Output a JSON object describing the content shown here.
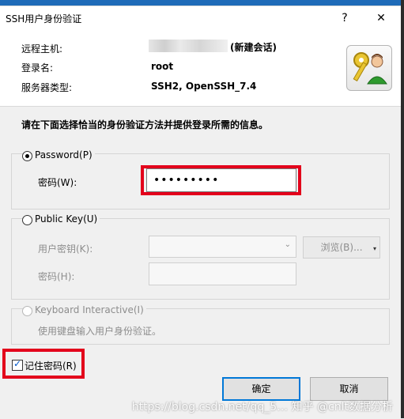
{
  "dialog": {
    "title": "SSH用户身份验证",
    "help_button": "?",
    "close_button": "✕"
  },
  "info": {
    "remote_host_label": "远程主机:",
    "remote_host_note": "(新建会话)",
    "username_label": "登录名:",
    "username_value": "root",
    "server_type_label": "服务器类型:",
    "server_type_value": "SSH2, OpenSSH_7.4"
  },
  "instruction": "请在下面选择恰当的身份验证方法并提供登录所需的信息。",
  "password_method": {
    "label": "Password(P)",
    "selected": true,
    "field_label": "密码(W):",
    "field_value": "•••••••••"
  },
  "public_key_method": {
    "label": "Public Key(U)",
    "selected": false,
    "user_key_label": "用户密钥(K):",
    "browse_button": "浏览(B)...",
    "passphrase_label": "密码(H):"
  },
  "keyboard_interactive_method": {
    "label": "Keyboard Interactive(I)",
    "selected": false,
    "description": "使用键盘输入用户身份验证。"
  },
  "remember_password": {
    "label": "记住密码(R)",
    "checked": true
  },
  "buttons": {
    "ok": "确定",
    "cancel": "取消"
  },
  "watermark": "https://blog.csdn.net/qq_5…  知乎 @cnlt数据分析"
}
